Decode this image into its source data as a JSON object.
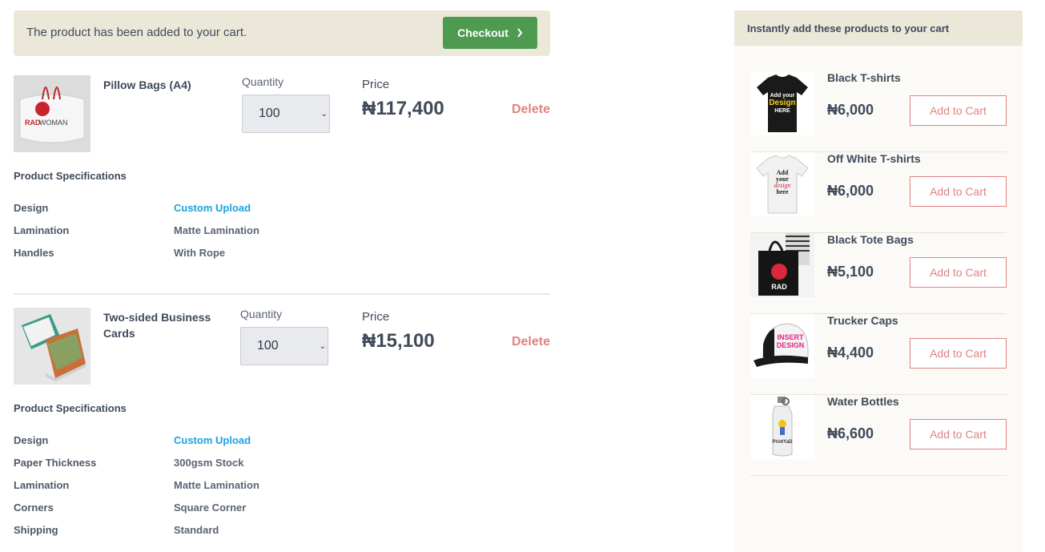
{
  "banner": {
    "message": "The product has been added to your cart.",
    "checkout_label": "Checkout"
  },
  "cart": {
    "quantity_label": "Quantity",
    "price_label": "Price",
    "delete_label": "Delete",
    "specs_title": "Product Specifications",
    "items": [
      {
        "name": "Pillow Bags (A4)",
        "quantity": "100",
        "price": "₦117,400",
        "thumb_text": [
          "RAD",
          "WOMAN"
        ],
        "specs": [
          {
            "key": "Design",
            "value": "Custom Upload",
            "link": true
          },
          {
            "key": "Lamination",
            "value": "Matte Lamination"
          },
          {
            "key": "Handles",
            "value": "With Rope"
          }
        ]
      },
      {
        "name": "Two-sided Business Cards",
        "quantity": "100",
        "price": "₦15,100",
        "specs": [
          {
            "key": "Design",
            "value": "Custom Upload",
            "link": true
          },
          {
            "key": "Paper Thickness",
            "value": "300gsm Stock"
          },
          {
            "key": "Lamination",
            "value": "Matte Lamination"
          },
          {
            "key": "Corners",
            "value": "Square Corner"
          },
          {
            "key": "Shipping",
            "value": "Standard"
          }
        ]
      }
    ]
  },
  "sidebar": {
    "title": "Instantly add these products to your cart",
    "add_label": "Add to Cart",
    "products": [
      {
        "name": "Black T-shirts",
        "price": "₦6,000",
        "thumb_text": [
          "Add your",
          "Design",
          "HERE"
        ]
      },
      {
        "name": "Off White T-shirts",
        "price": "₦6,000",
        "thumb_text": [
          "Add",
          "your",
          "design",
          "here"
        ]
      },
      {
        "name": "Black Tote Bags",
        "price": "₦5,100",
        "thumb_text": [
          "RAD"
        ]
      },
      {
        "name": "Trucker Caps",
        "price": "₦4,400",
        "thumb_text": [
          "INSERT",
          "DESIGN"
        ]
      },
      {
        "name": "Water Bottles",
        "price": "₦6,600",
        "thumb_text": [
          "PrintYaD"
        ]
      }
    ]
  },
  "colors": {
    "accent_green": "#4e9a51",
    "delete_red": "#e08282",
    "link_blue": "#1fa1de",
    "banner_bg": "#ece8d9"
  }
}
